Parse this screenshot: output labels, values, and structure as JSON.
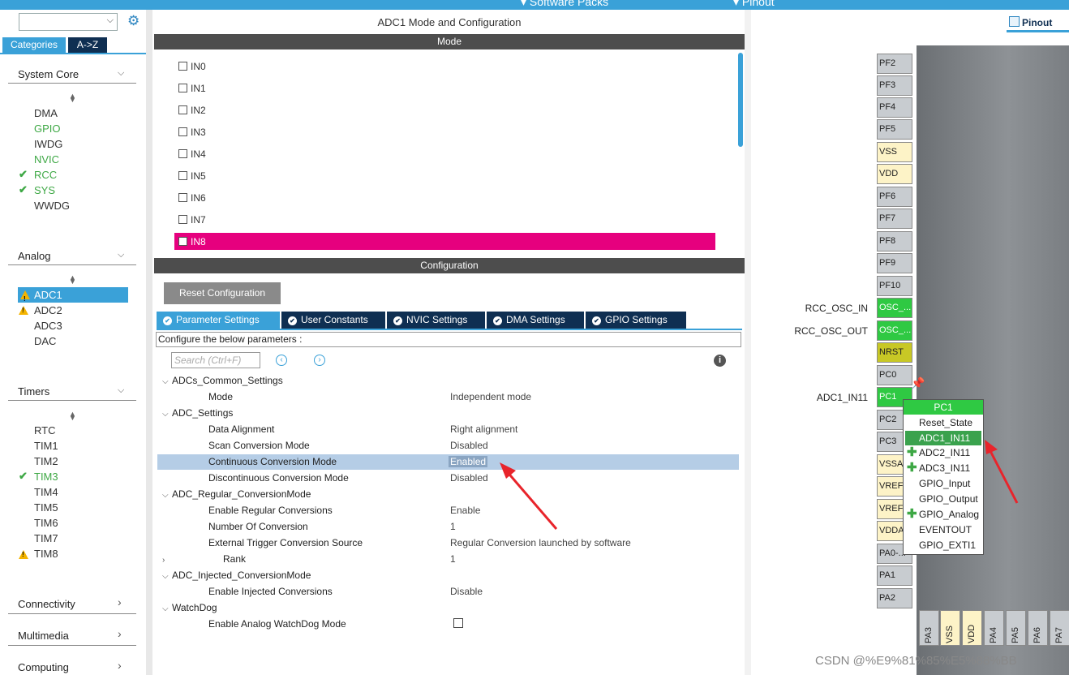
{
  "topbar": {
    "software_packs": "Software Packs",
    "pinout": "Pinout"
  },
  "sidebar": {
    "tabs": {
      "categories": "Categories",
      "az": "A->Z"
    },
    "groups": {
      "system_core": {
        "title": "System Core",
        "items": [
          "DMA",
          "GPIO",
          "IWDG",
          "NVIC",
          "RCC",
          "SYS",
          "WWDG"
        ]
      },
      "analog": {
        "title": "Analog",
        "items": [
          "ADC1",
          "ADC2",
          "ADC3",
          "DAC"
        ]
      },
      "timers": {
        "title": "Timers",
        "items": [
          "RTC",
          "TIM1",
          "TIM2",
          "TIM3",
          "TIM4",
          "TIM5",
          "TIM6",
          "TIM7",
          "TIM8"
        ]
      },
      "connectivity": {
        "title": "Connectivity"
      },
      "multimedia": {
        "title": "Multimedia"
      },
      "computing": {
        "title": "Computing"
      }
    }
  },
  "center": {
    "title": "ADC1 Mode and Configuration",
    "mode_bar": "Mode",
    "mode_items": [
      "IN0",
      "IN1",
      "IN2",
      "IN3",
      "IN4",
      "IN5",
      "IN6",
      "IN7",
      "IN8"
    ],
    "config_bar": "Configuration",
    "reset_button": "Reset Configuration",
    "tabs": [
      "Parameter Settings",
      "User Constants",
      "NVIC Settings",
      "DMA Settings",
      "GPIO Settings"
    ],
    "configure_label": "Configure the below parameters :",
    "search_placeholder": "Search (Ctrl+F)",
    "tree": {
      "common": "ADCs_Common_Settings",
      "mode": {
        "label": "Mode",
        "value": "Independent mode"
      },
      "adc_settings": "ADC_Settings",
      "data_alignment": {
        "label": "Data Alignment",
        "value": "Right alignment"
      },
      "scan": {
        "label": "Scan Conversion Mode",
        "value": "Disabled"
      },
      "continuous": {
        "label": "Continuous Conversion Mode",
        "value": "Enabled"
      },
      "discontinuous": {
        "label": "Discontinuous Conversion Mode",
        "value": "Disabled"
      },
      "regular": "ADC_Regular_ConversionMode",
      "enable_regular": {
        "label": "Enable Regular Conversions",
        "value": "Enable"
      },
      "num_conv": {
        "label": "Number Of Conversion",
        "value": "1"
      },
      "ext_trigger": {
        "label": "External Trigger Conversion Source",
        "value": "Regular Conversion launched by software"
      },
      "rank": {
        "label": "Rank",
        "value": "1"
      },
      "injected": "ADC_Injected_ConversionMode",
      "enable_injected": {
        "label": "Enable Injected Conversions",
        "value": "Disable"
      },
      "watchdog": "WatchDog",
      "enable_wd": {
        "label": "Enable Analog WatchDog Mode"
      }
    }
  },
  "pinout": {
    "tab": "Pinout",
    "pins": [
      "PF2",
      "PF3",
      "PF4",
      "PF5",
      "VSS",
      "VDD",
      "PF6",
      "PF7",
      "PF8",
      "PF9",
      "PF10",
      "OSC_...",
      "OSC_...",
      "NRST",
      "PC0",
      "PC1",
      "PC2",
      "PC3",
      "VSSA",
      "VREF",
      "VREF",
      "VDDA",
      "PA0-...",
      "PA1",
      "PA2"
    ],
    "labels": {
      "osc_in": "RCC_OSC_IN",
      "osc_out": "RCC_OSC_OUT",
      "adc_in11": "ADC1_IN11"
    },
    "bottom_pins": [
      "PA3",
      "VSS",
      "VDD",
      "PA4",
      "PA5",
      "PA6",
      "PA7"
    ],
    "popup": {
      "header": "PC1",
      "items": [
        "Reset_State",
        "ADC1_IN11",
        "ADC2_IN11",
        "ADC3_IN11",
        "GPIO_Input",
        "GPIO_Output",
        "GPIO_Analog",
        "EVENTOUT",
        "GPIO_EXTI1"
      ]
    }
  },
  "watermark": "CSDN @%E9%81%85%E5%88%BB",
  "colors": {
    "accent": "#3aa1d8",
    "navy": "#0f2f52",
    "magenta": "#e6007e",
    "green": "#2fc943",
    "arrow": "#e8242b"
  }
}
